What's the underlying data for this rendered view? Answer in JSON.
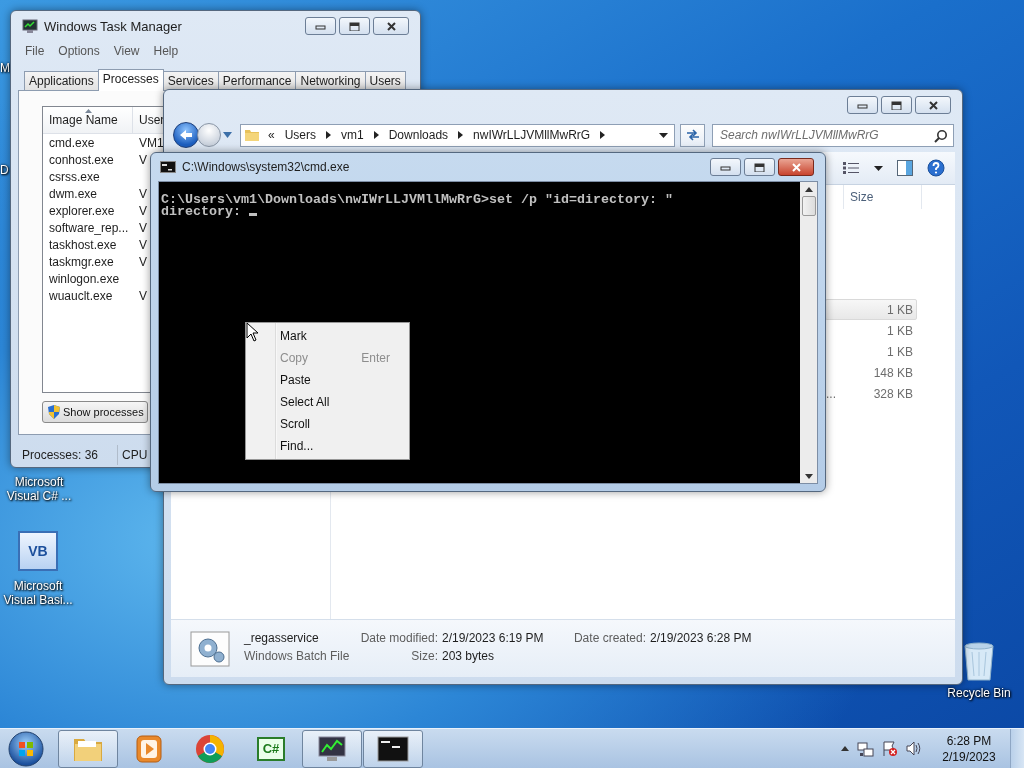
{
  "desktop_icons": [
    {
      "kind": "label_only",
      "label": "M"
    },
    {
      "kind": "label_only",
      "label": "D"
    },
    {
      "kind": "label_only",
      "label": "Microsoft Visual C# ..."
    },
    {
      "kind": "program",
      "label": "Microsoft Visual Basi...",
      "logo": "VB"
    },
    {
      "kind": "recycle_bin",
      "label": "Recycle Bin"
    }
  ],
  "task_manager": {
    "active": false,
    "title": "Windows Task Manager",
    "menu": [
      "File",
      "Options",
      "View",
      "Help"
    ],
    "tabs": [
      {
        "label": "Applications",
        "selected": false
      },
      {
        "label": "Processes",
        "selected": true
      },
      {
        "label": "Services",
        "selected": false
      },
      {
        "label": "Performance",
        "selected": false
      },
      {
        "label": "Networking",
        "selected": false
      },
      {
        "label": "Users",
        "selected": false
      }
    ],
    "columns": [
      {
        "label": "Image Name",
        "sorted": true
      },
      {
        "label": "User",
        "sorted": false
      }
    ],
    "rows": [
      {
        "image_name": "cmd.exe",
        "user": "VM1"
      },
      {
        "image_name": "conhost.exe",
        "user": "V"
      },
      {
        "image_name": "csrss.exe"
      },
      {
        "image_name": "dwm.exe",
        "user": "V"
      },
      {
        "image_name": "explorer.exe",
        "user": "V"
      },
      {
        "image_name": "software_rep...",
        "user": "V"
      },
      {
        "image_name": "taskhost.exe",
        "user": "V"
      },
      {
        "image_name": "taskmgr.exe",
        "user": "V"
      },
      {
        "image_name": "winlogon.exe"
      },
      {
        "image_name": "wuauclt.exe",
        "user": "V"
      }
    ],
    "button": "Show processes",
    "status": [
      "Processes: 36",
      "CPU"
    ]
  },
  "explorer": {
    "active": false,
    "overflow": "«",
    "breadcrumbs": [
      "Users",
      "vm1",
      "Downloads",
      "nwIWrLLJVMllMwRrG"
    ],
    "search": {
      "placeholder": "Search nwIWrLLJVMllMwRrG"
    },
    "columns": [
      "Size"
    ],
    "files": [
      {
        "size": "1 KB",
        "highlighted": true
      },
      {
        "size": "1 KB",
        "highlighted": false
      },
      {
        "size": "1 KB",
        "highlighted": false
      },
      {
        "size": "148 KB",
        "highlighted": false
      },
      {
        "type": "...",
        "size": "328 KB",
        "highlighted": false
      }
    ],
    "details": {
      "name": "_regasservice",
      "type": "Windows Batch File",
      "fields": [
        {
          "label": "Date modified:",
          "value": "2/19/2023 6:19 PM"
        },
        {
          "label": "Size:",
          "value": "203 bytes"
        },
        {
          "label": "Date created:",
          "value": "2/19/2023 6:28 PM"
        }
      ]
    }
  },
  "console": {
    "active": true,
    "title": "C:\\Windows\\system32\\cmd.exe",
    "lines": [
      "C:\\Users\\vm1\\Downloads\\nwIWrLLJVMllMwRrG>set /p \"id=directory: \"",
      "directory: "
    ],
    "cursor": true,
    "context_menu": [
      {
        "label": "Mark",
        "disabled": false
      },
      {
        "label": "Copy",
        "disabled": true,
        "shortcut": "Enter"
      },
      {
        "label": "Paste",
        "disabled": false
      },
      {
        "label": "Select All",
        "disabled": false
      },
      {
        "label": "Scroll",
        "disabled": false
      },
      {
        "label": "Find...",
        "disabled": false
      }
    ]
  },
  "taskbar": {
    "apps": [
      {
        "kind": "folder",
        "open": true
      },
      {
        "kind": "media",
        "open": false
      },
      {
        "kind": "browser",
        "open": false
      },
      {
        "kind": "csharp",
        "open": false,
        "logo": "C#"
      },
      {
        "kind": "taskmgr",
        "open": true
      },
      {
        "kind": "console",
        "open": true
      }
    ],
    "clock": {
      "time": "6:28 PM",
      "date": "2/19/2023"
    }
  }
}
